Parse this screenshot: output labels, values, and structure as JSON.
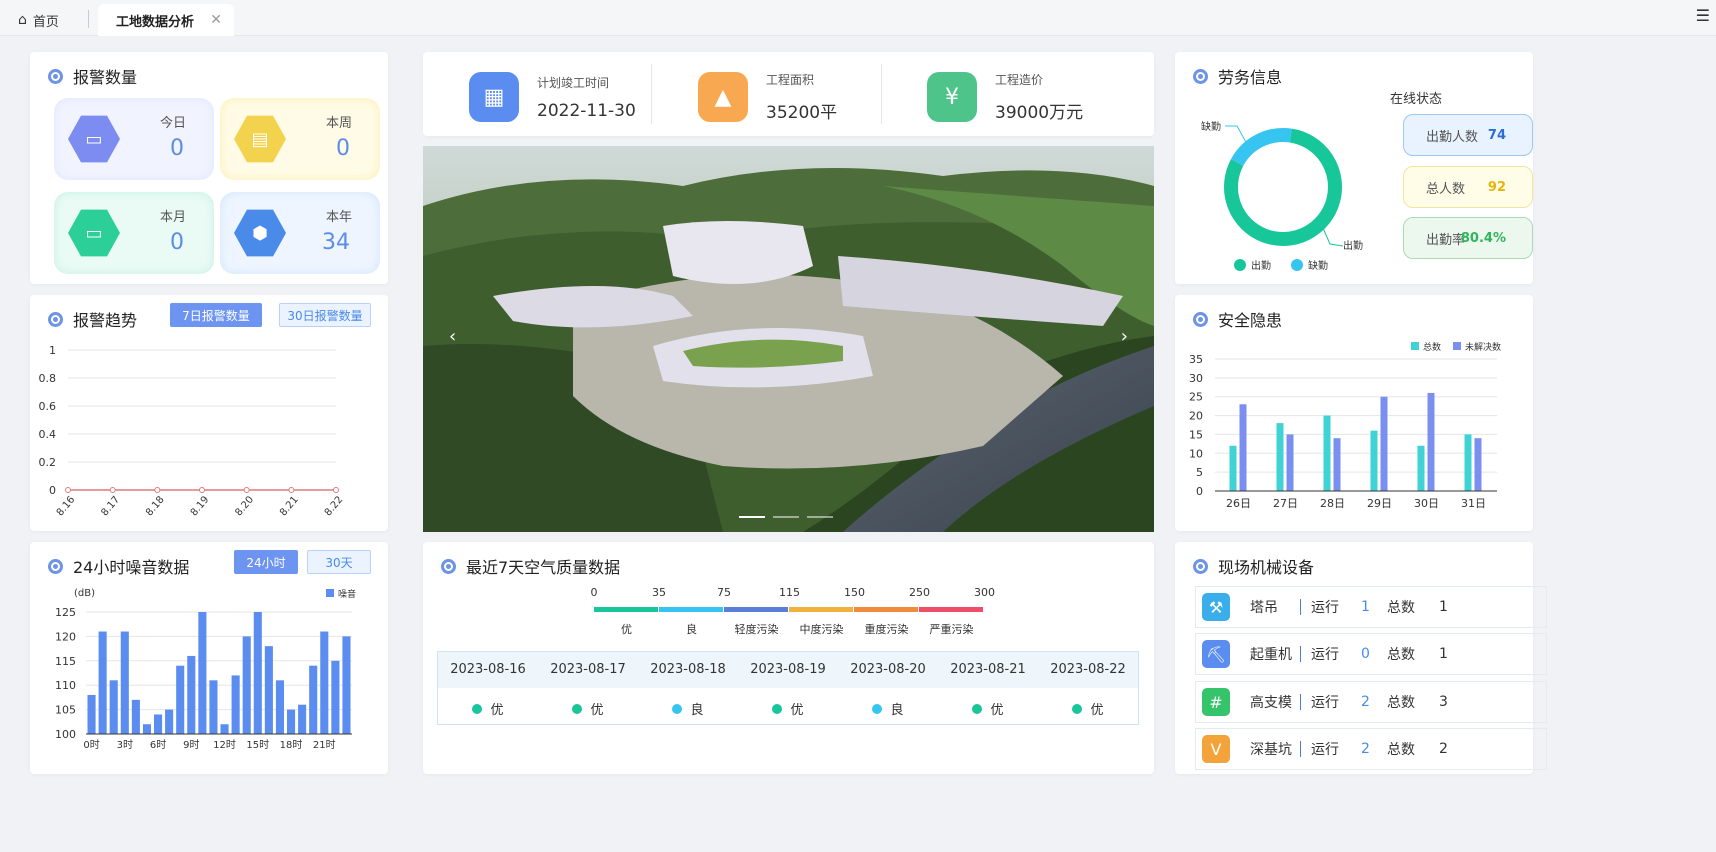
{
  "tabs": {
    "home": "首页",
    "active": "工地数据分析"
  },
  "alarm": {
    "title": "报警数量",
    "items": [
      {
        "label": "今日",
        "value": "0"
      },
      {
        "label": "本周",
        "value": "0"
      },
      {
        "label": "本月",
        "value": "0"
      },
      {
        "label": "本年",
        "value": "34"
      }
    ]
  },
  "trend": {
    "title": "报警趋势",
    "btn7": "7日报警数量",
    "btn30": "30日报警数量"
  },
  "noise": {
    "title": "24小时噪音数据",
    "btn24": "24小时",
    "btn30": "30天",
    "unit": "(dB)",
    "legend": "噪音"
  },
  "project": {
    "items": [
      {
        "label": "计划竣工时间",
        "value": "2022-11-30"
      },
      {
        "label": "工程面积",
        "value": "35200平"
      },
      {
        "label": "工程造价",
        "value": "39000万元"
      }
    ]
  },
  "air": {
    "title": "最近7天空气质量数据",
    "scale": [
      "0",
      "35",
      "75",
      "115",
      "150",
      "250",
      "300"
    ],
    "levels": [
      "优",
      "良",
      "轻度污染",
      "中度污染",
      "重度污染",
      "严重污染"
    ],
    "level_colors": [
      "#19c59a",
      "#36c5f0",
      "#5b7fd8",
      "#f0b23c",
      "#f08a3c",
      "#ee4e6a"
    ],
    "dates": [
      "2023-08-16",
      "2023-08-17",
      "2023-08-18",
      "2023-08-19",
      "2023-08-20",
      "2023-08-21",
      "2023-08-22"
    ],
    "quality": [
      "优",
      "优",
      "良",
      "优",
      "良",
      "优",
      "优"
    ]
  },
  "labor": {
    "title": "劳务信息",
    "status_title": "在线状态",
    "legend": [
      "出勤",
      "缺勤"
    ],
    "stats": [
      {
        "label": "出勤人数",
        "value": "74"
      },
      {
        "label": "总人数",
        "value": "92"
      },
      {
        "label": "出勤率",
        "value": "80.4%"
      }
    ]
  },
  "safety": {
    "title": "安全隐患",
    "legend": [
      "总数",
      "未解决数"
    ]
  },
  "machines": {
    "title": "现场机械设备",
    "run_label": "运行",
    "total_label": "总数",
    "items": [
      {
        "name": "塔吊",
        "run": "1",
        "total": "1"
      },
      {
        "name": "起重机",
        "run": "0",
        "total": "1"
      },
      {
        "name": "高支模",
        "run": "2",
        "total": "3"
      },
      {
        "name": "深基坑",
        "run": "2",
        "total": "2"
      }
    ]
  },
  "chart_data": [
    {
      "type": "line",
      "title": "报警趋势",
      "categories": [
        "8.16",
        "8.17",
        "8.18",
        "8.19",
        "8.20",
        "8.21",
        "8.22"
      ],
      "values": [
        0,
        0,
        0,
        0,
        0,
        0,
        0
      ],
      "ylim": [
        0,
        1
      ],
      "yticks": [
        "0",
        "0.2",
        "0.4",
        "0.6",
        "0.8",
        "1"
      ]
    },
    {
      "type": "bar",
      "title": "24小时噪音数据",
      "ylabel": "(dB)",
      "series_name": "噪音",
      "ylim": [
        100,
        125
      ],
      "yticks": [
        "100",
        "105",
        "110",
        "115",
        "120",
        "125"
      ],
      "xticks": [
        "0时",
        "3时",
        "6时",
        "9时",
        "12时",
        "15时",
        "18时",
        "21时"
      ],
      "values": [
        108,
        121,
        111,
        121,
        107,
        102,
        104,
        105,
        114,
        116,
        125,
        111,
        102,
        112,
        120,
        125,
        118,
        111,
        105,
        106,
        114,
        121,
        115,
        120
      ]
    },
    {
      "type": "bar",
      "title": "安全隐患",
      "categories": [
        "26日",
        "27日",
        "28日",
        "29日",
        "30日",
        "31日"
      ],
      "ylim": [
        0,
        35
      ],
      "yticks": [
        "0",
        "5",
        "10",
        "15",
        "20",
        "25",
        "30",
        "35"
      ],
      "series": [
        {
          "name": "总数",
          "values": [
            12,
            18,
            20,
            16,
            12,
            15
          ]
        },
        {
          "name": "未解决数",
          "values": [
            23,
            15,
            14,
            25,
            26,
            14
          ]
        }
      ]
    },
    {
      "type": "pie",
      "title": "劳务信息",
      "series": [
        {
          "name": "出勤",
          "value": 74
        },
        {
          "name": "缺勤",
          "value": 18
        }
      ]
    }
  ]
}
